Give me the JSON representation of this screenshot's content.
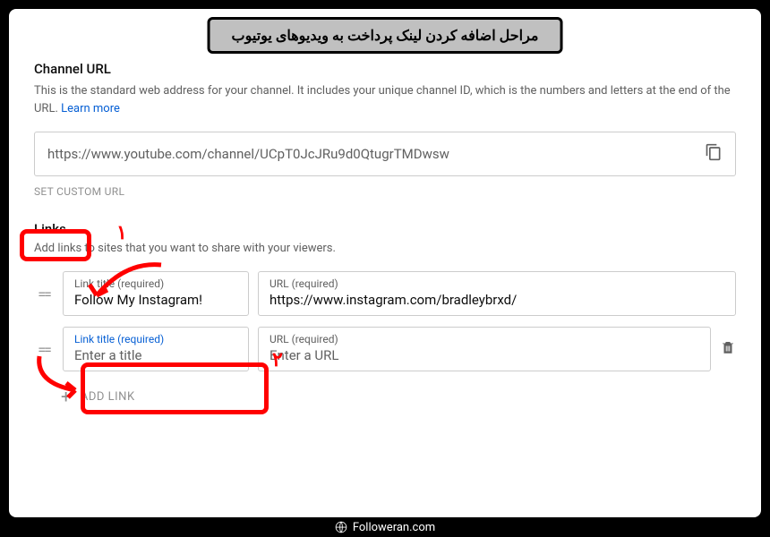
{
  "banner": {
    "text": "مراحل اضافه کردن لینک پرداخت به ویدیوهای یوتیوب"
  },
  "channel": {
    "title": "Channel URL",
    "desc": "This is the standard web address for your channel. It includes your unique channel ID, which is the numbers and letters at the end of the URL. ",
    "learn": "Learn more",
    "url": "https://www.youtube.com/channel/UCpT0JcJRu9d0QtugrTMDwsw",
    "setCustom": "SET CUSTOM URL"
  },
  "links": {
    "title": "Links",
    "desc": "Add links to sites that you want to share with your viewers.",
    "titleLabel": "Link title (required)",
    "urlLabel": "URL (required)",
    "rows": [
      {
        "title": "Follow My Instagram!",
        "url": "https://www.instagram.com/bradleybrxd/"
      },
      {
        "titlePlaceholder": "Enter a title",
        "urlPlaceholder": "Enter a URL"
      }
    ],
    "addLink": "ADD LINK"
  },
  "annotations": {
    "num1": "۱",
    "num2": "۲"
  },
  "footer": {
    "text": "Followeran.com"
  }
}
